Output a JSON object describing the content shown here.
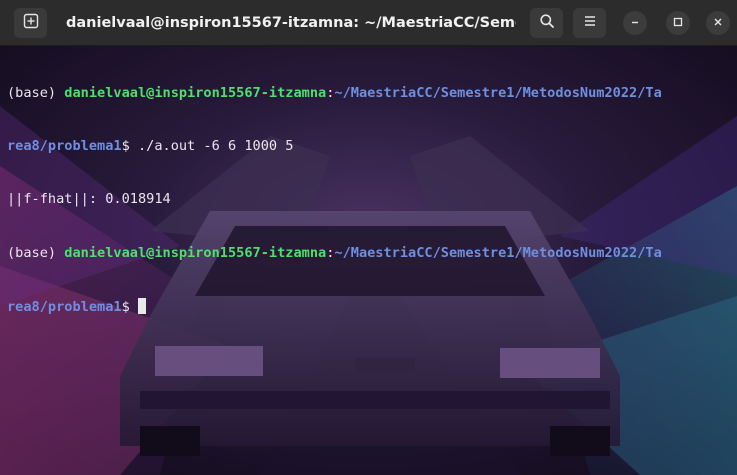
{
  "window": {
    "title": "danielvaal@inspiron15567-itzamna: ~/MaestriaCC/Semestre1..."
  },
  "titlebar": {
    "new_tab_icon": "new-tab-icon",
    "search_icon": "search-icon",
    "menu_icon": "hamburger-menu-icon",
    "minimize_icon": "minimize-icon",
    "maximize_icon": "maximize-icon",
    "close_icon": "close-icon"
  },
  "terminal": {
    "lines": [
      {
        "env": "(base) ",
        "user": "danielvaal@inspiron15567-itzamna",
        "sep": ":",
        "path_a": "~/MaestriaCC/Semestre1/MetodosNum2022/Ta",
        "path_b": "rea8/problema1",
        "prompt": "$ ",
        "command": "./a.out -6 6 1000 5"
      },
      {
        "output": "||f-fhat||: 0.018914"
      },
      {
        "env": "(base) ",
        "user": "danielvaal@inspiron15567-itzamna",
        "sep": ":",
        "path_a": "~/MaestriaCC/Semestre1/MetodosNum2022/Ta",
        "path_b": "rea8/problema1",
        "prompt": "$ "
      }
    ]
  },
  "colors": {
    "titlebar_bg": "#2c2c2c",
    "user_green": "#4ee06a",
    "path_blue": "#6f8fe0",
    "text": "#ece6ef"
  }
}
